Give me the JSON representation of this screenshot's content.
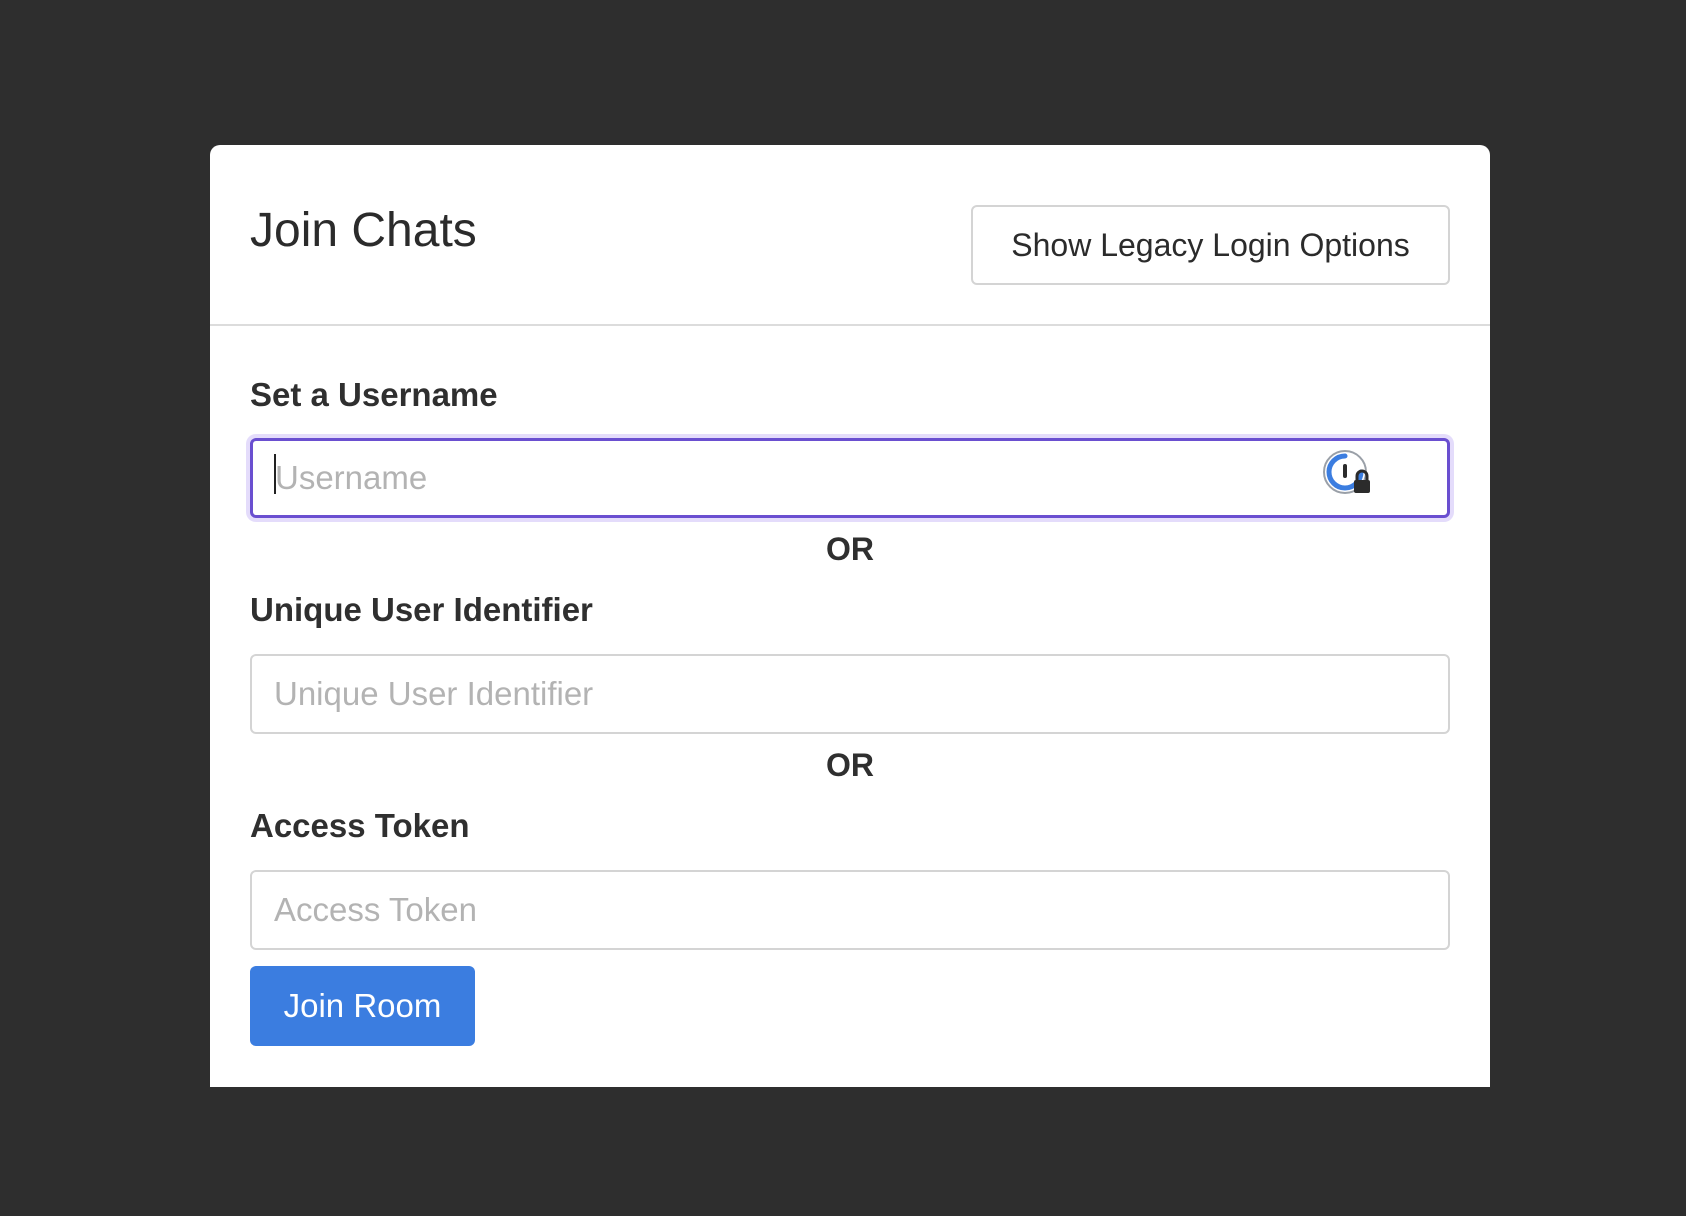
{
  "header": {
    "title": "Join Chats",
    "legacy_button_label": "Show Legacy Login Options"
  },
  "username": {
    "label": "Set a Username",
    "placeholder": "Username",
    "value": ""
  },
  "or_1": "OR",
  "uid": {
    "label": "Unique User Identifier",
    "placeholder": "Unique User Identifier",
    "value": ""
  },
  "or_2": "OR",
  "token": {
    "label": "Access Token",
    "placeholder": "Access Token",
    "value": ""
  },
  "join_button_label": "Join Room",
  "colors": {
    "page_background": "#2e2e2e",
    "panel_background": "#ffffff",
    "primary": "#3b7de0",
    "focus_border": "#6a4fd0"
  },
  "icons": {
    "password_manager": "password-manager-lock-icon"
  }
}
